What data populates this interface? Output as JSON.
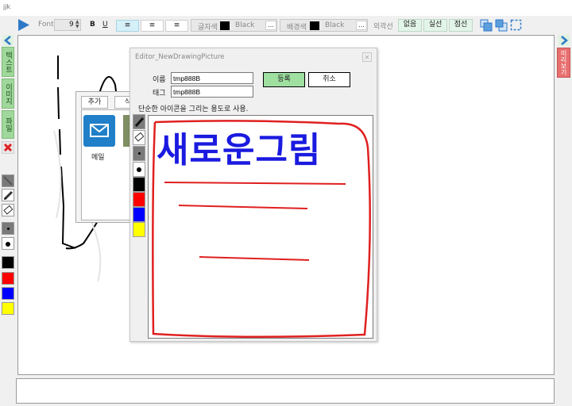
{
  "window": {
    "title": "jjk"
  },
  "toolbar": {
    "font_label": "Font",
    "font_size": "9",
    "bold_label": "B",
    "underline_label": "U",
    "align_icons": [
      "align-left-icon",
      "align-center-icon",
      "align-right-icon"
    ],
    "text_color_label": "글자색",
    "text_color_value": "Black",
    "bg_color_label": "배경색",
    "bg_color_value": "Black",
    "ellipsis": "...",
    "outline_label": "외곽선",
    "outline_none": "없음",
    "outline_solid": "실선",
    "outline_dotted": "점선"
  },
  "left_panel": {
    "tabs": [
      "텍스트",
      "이미지",
      "파일"
    ],
    "palette_colors": [
      "#000000",
      "#ff0000",
      "#0000ff",
      "#ffff00"
    ]
  },
  "right_panel": {
    "preview_label": "미리보기"
  },
  "back_dialog": {
    "tab_add": "추가",
    "tab_delete": "삭",
    "item_label": "메일"
  },
  "editor": {
    "title": "Editor_NewDrawingPicture",
    "name_label": "이름",
    "name_value": "tmp888B",
    "tag_label": "태그",
    "tag_value": "tmp888B",
    "register_label": "등록",
    "cancel_label": "취소",
    "description": "단순한 아이콘을 그리는 용도로 사용.",
    "drawn_text": "새로운그림",
    "palette_colors": [
      "#000000",
      "#ff0000",
      "#0000ff",
      "#ffff00"
    ]
  },
  "colors": {
    "accent_green": "#9fd89a",
    "preview_red": "#e86f6f",
    "register_green": "#9fe0a0",
    "stroke_red": "#e02020",
    "stroke_blue": "#1a1ae0"
  }
}
